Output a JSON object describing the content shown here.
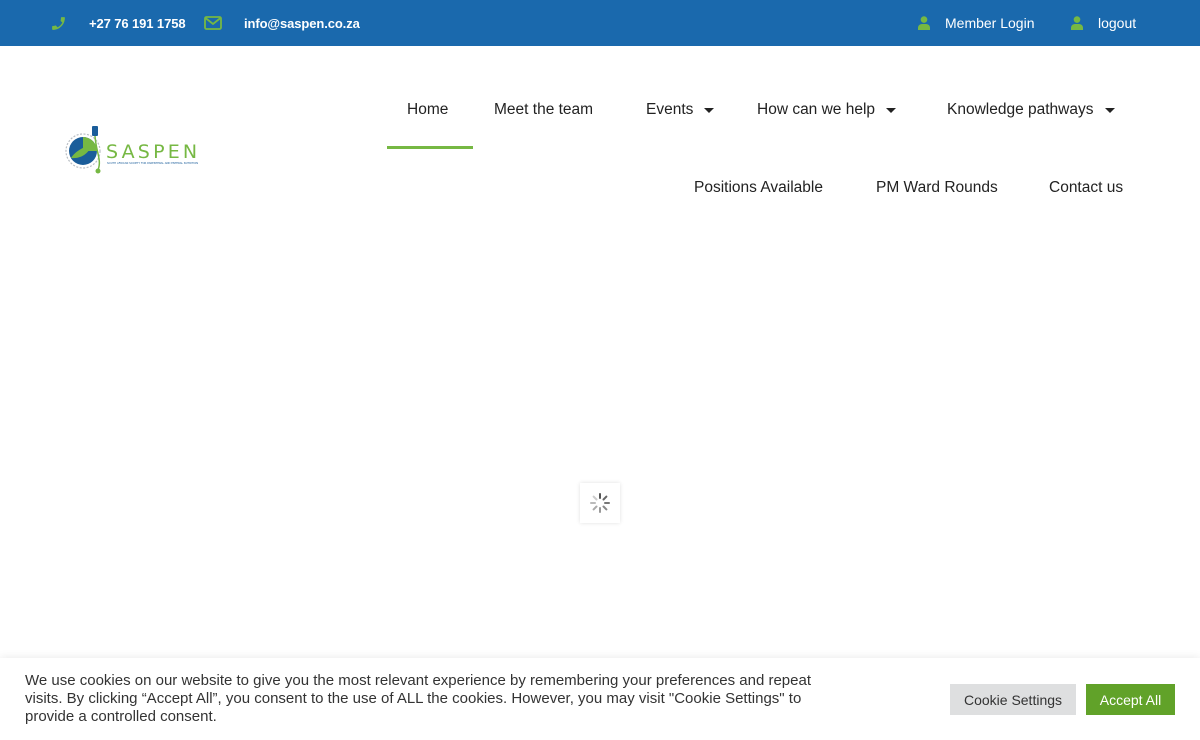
{
  "topbar": {
    "phone": "+27 76 191 1758",
    "email": "info@saspen.co.za",
    "member_login": "Member Login",
    "logout": "logout"
  },
  "logo": {
    "name": "SASPEN",
    "tagline": "SOUTH AFRICAN SOCIETY FOR PARENTERAL AND ENTERAL NUTRITION"
  },
  "nav": {
    "items": [
      {
        "label": "Home",
        "active": true
      },
      {
        "label": "Meet the team"
      },
      {
        "label": "Events",
        "dropdown": true
      },
      {
        "label": "How can we help",
        "dropdown": true
      },
      {
        "label": "Knowledge pathways",
        "dropdown": true
      },
      {
        "label": "Positions Available"
      },
      {
        "label": "PM Ward Rounds"
      },
      {
        "label": "Contact us"
      }
    ]
  },
  "cookie": {
    "text": "We use cookies on our website to give you the most relevant experience by remembering your preferences and repeat visits. By clicking “Accept All”, you consent to the use of ALL the cookies. However, you may visit \"Cookie Settings\" to provide a controlled consent.",
    "settings_label": "Cookie Settings",
    "accept_label": "Accept All"
  },
  "colors": {
    "topbar": "#1a69ad",
    "accent_green": "#76b843",
    "accept_button": "#61a229"
  },
  "icons": {
    "phone": "phone-icon",
    "email": "envelope-icon",
    "user": "user-icon",
    "loader": "spinner-icon"
  }
}
